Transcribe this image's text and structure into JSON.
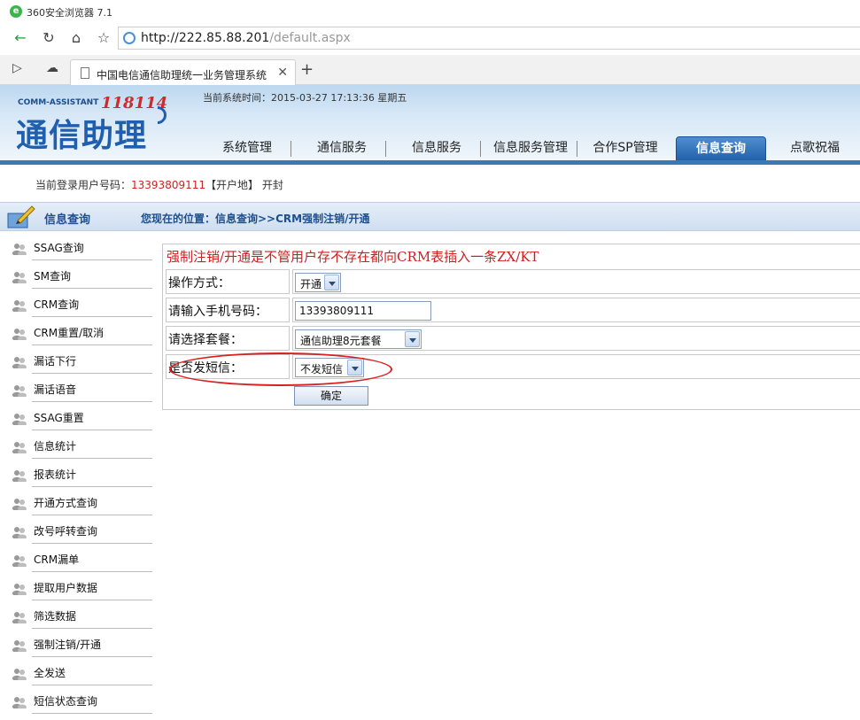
{
  "browser": {
    "app_title": "360安全浏览器 7.1",
    "url_host": "http://222.85.88.201",
    "url_path": "/default.aspx",
    "tab_title": "中国电信通信助理统一业务管理系统"
  },
  "header": {
    "brand_en": "COMM-ASSISTANT",
    "brand_num": "118114",
    "brand_cn": "通信助理",
    "system_time": "当前系统时间：2015-03-27 17:13:36 星期五",
    "nav": [
      "系统管理",
      "通信服务",
      "信息服务",
      "信息服务管理",
      "合作SP管理",
      "信息查询",
      "点歌祝福"
    ],
    "active_nav": "信息查询"
  },
  "user": {
    "label": "当前登录用户号码：",
    "phone": "13393809111",
    "area": "【开户地】 开封"
  },
  "location": {
    "section": "信息查询",
    "breadcrumb": "您现在的位置：信息查询>>CRM强制注销/开通"
  },
  "sidebar": {
    "items": [
      "SSAG查询",
      "SM查询",
      "CRM查询",
      "CRM重置/取消",
      "漏话下行",
      "漏话语音",
      "SSAG重置",
      "信息统计",
      "报表统计",
      "开通方式查询",
      "改号呼转查询",
      "CRM漏单",
      "提取用户数据",
      "筛选数据",
      "强制注销/开通",
      "全发送",
      "短信状态查询"
    ]
  },
  "form": {
    "heading": "强制注销/开通是不管用户存不存在都向CRM表插入一条ZX/KT",
    "op_label": "操作方式：",
    "op_value": "开通",
    "phone_label": "请输入手机号码：",
    "phone_value": "13393809111",
    "package_label": "请选择套餐：",
    "package_value": "通信助理8元套餐",
    "sms_label": "是否发短信：",
    "sms_value": "不发短信",
    "submit_label": "确定"
  },
  "colors": {
    "header_blue": "#3a79b7",
    "active_tab": "#1d5ea7",
    "alert_red": "#d01e1e",
    "highlight_oval": "#d92121"
  }
}
